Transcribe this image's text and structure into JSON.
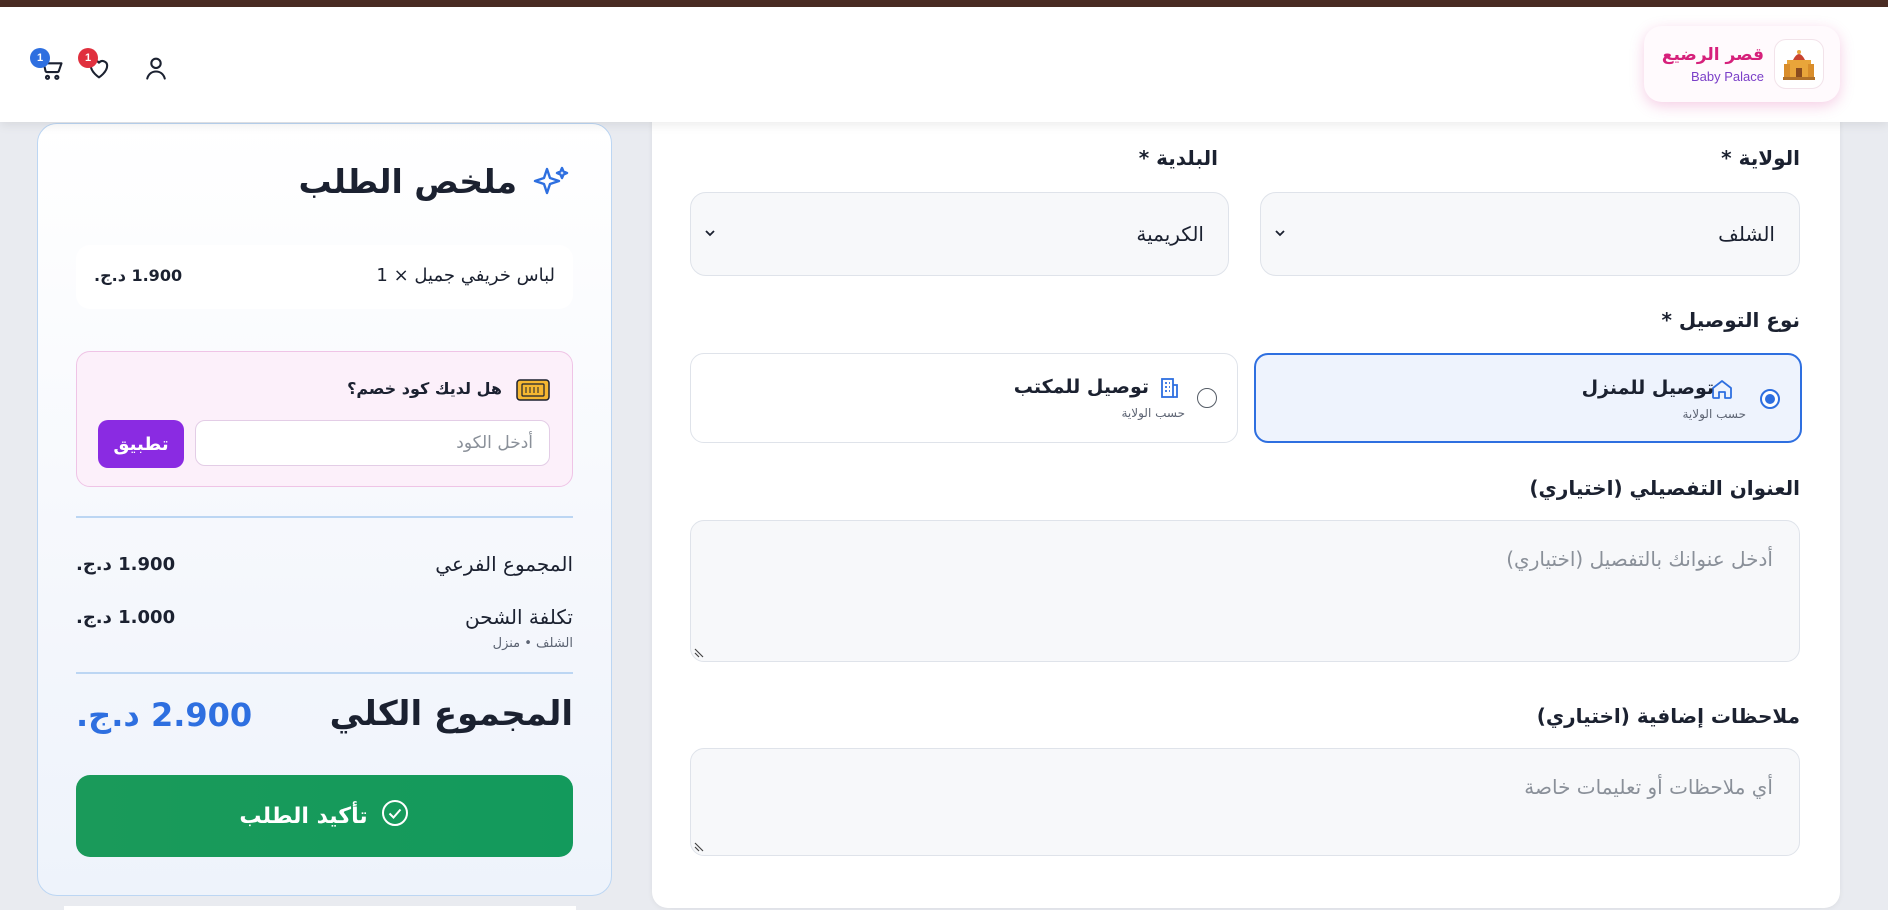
{
  "header": {
    "logo": {
      "name_ar": "قصر الرضيع",
      "name_en": "Baby Palace"
    },
    "cart_count": "1",
    "wishlist_count": "1"
  },
  "form": {
    "wilaya": {
      "label": "الولاية *",
      "value": "الشلف"
    },
    "commune": {
      "label": "البلدية *",
      "value": "الكريمية"
    },
    "delivery": {
      "label": "نوع التوصيل *",
      "options": [
        {
          "title": "توصيل للمنزل",
          "subtitle": "حسب الولاية",
          "selected": true
        },
        {
          "title": "توصيل للمكتب",
          "subtitle": "حسب الولاية",
          "selected": false
        }
      ]
    },
    "address": {
      "label": "العنوان التفصيلي (اختياري)",
      "placeholder": "أدخل عنوانك بالتفصيل (اختياري)"
    },
    "notes": {
      "label": "ملاحظات إضافية (اختياري)",
      "placeholder": "أي ملاحظات أو تعليمات خاصة"
    }
  },
  "summary": {
    "title": "ملخص الطلب",
    "item": {
      "name": "لباس خريفي جميل × 1",
      "price": "1.900 د.ج."
    },
    "coupon": {
      "question": "هل لديك كود خصم؟",
      "placeholder": "أدخل الكود",
      "apply_label": "تطبيق"
    },
    "subtotal": {
      "label": "المجموع الفرعي",
      "value": "1.900 د.ج."
    },
    "shipping": {
      "label": "تكلفة الشحن",
      "value": "1.000 د.ج.",
      "note": "الشلف • منزل"
    },
    "total": {
      "label": "المجموع الكلي",
      "value": "2.900 د.ج."
    },
    "confirm_label": "تأكيد الطلب"
  },
  "colors": {
    "accent": "#2e6fe0",
    "confirm": "#139a5c",
    "apply": "#8a2be2",
    "badge_cart": "#2e6fe0",
    "badge_wishlist": "#e0303e"
  }
}
